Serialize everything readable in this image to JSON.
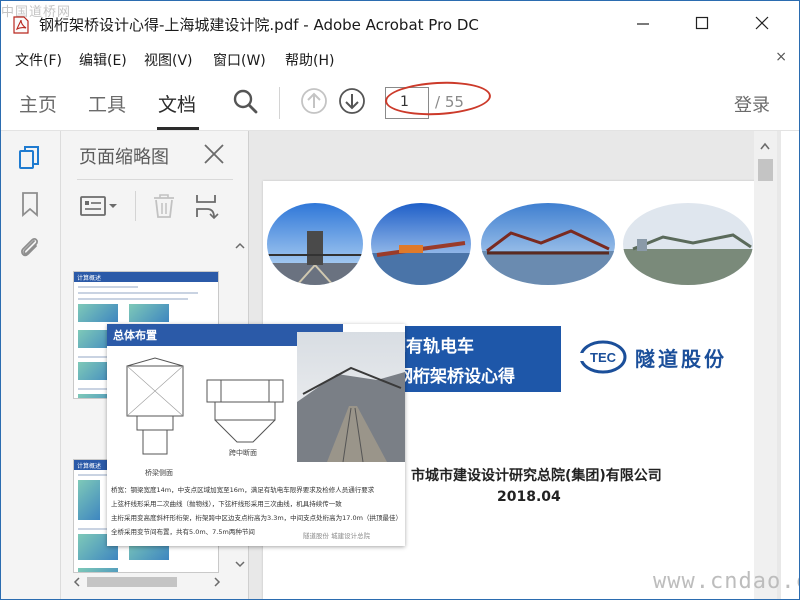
{
  "watermark_top": "中国道桥网",
  "watermark_bottom": "www.cndao.com",
  "window": {
    "title": "钢桁架桥设计心得-上海城建设计院.pdf - Adobe Acrobat Pro DC",
    "minimize_icon": "minimize-icon",
    "maximize_icon": "maximize-icon",
    "close_icon": "close-icon"
  },
  "menu": {
    "items": [
      "文件(F)",
      "编辑(E)",
      "视图(V)",
      "窗口(W)",
      "帮助(H)"
    ],
    "close_glyph": "×"
  },
  "toolbar": {
    "tabs": [
      "主页",
      "工具",
      "文档"
    ],
    "active_tab": "文档",
    "page_current": "1",
    "page_total": "/ 55",
    "login": "登录",
    "highlight_color": "#cc3a2a"
  },
  "panel": {
    "title": "页面缩略图",
    "thumb1_title": "计算概述",
    "thumb2_title": "计算概述"
  },
  "document": {
    "banner_line1": "期有轨电车",
    "banner_line2": "架钢桁架桥设心得",
    "logo_text": "TEC",
    "brand": "隧道股份",
    "institute": "市城市建设设计研究总院(集团)有限公司",
    "date": "2018.04",
    "brand_color": "#1b4f9a"
  },
  "overlay": {
    "title": "总体布置",
    "caption_left": "桥梁侧面",
    "caption_right": "跨中断面",
    "bullets": [
      "桥宽：钢梁宽度14m，中支点区域加宽至16m，满足有轨电车限界要求及检修人员通行要求",
      "上弦杆线形采用二次曲线（抛物线），下弦杆线形采用三次曲线，机具持续传一致",
      "主桁采用变高度斜杆形桁架，桁架跨中区边支点桁高为3.3m，中间支点处桁高为17.0m（拱顶最佳）",
      "全桥采用变节间布置，共有5.0m、7.5m两种节间"
    ],
    "footer": "隧道股份  城建设计总院"
  }
}
